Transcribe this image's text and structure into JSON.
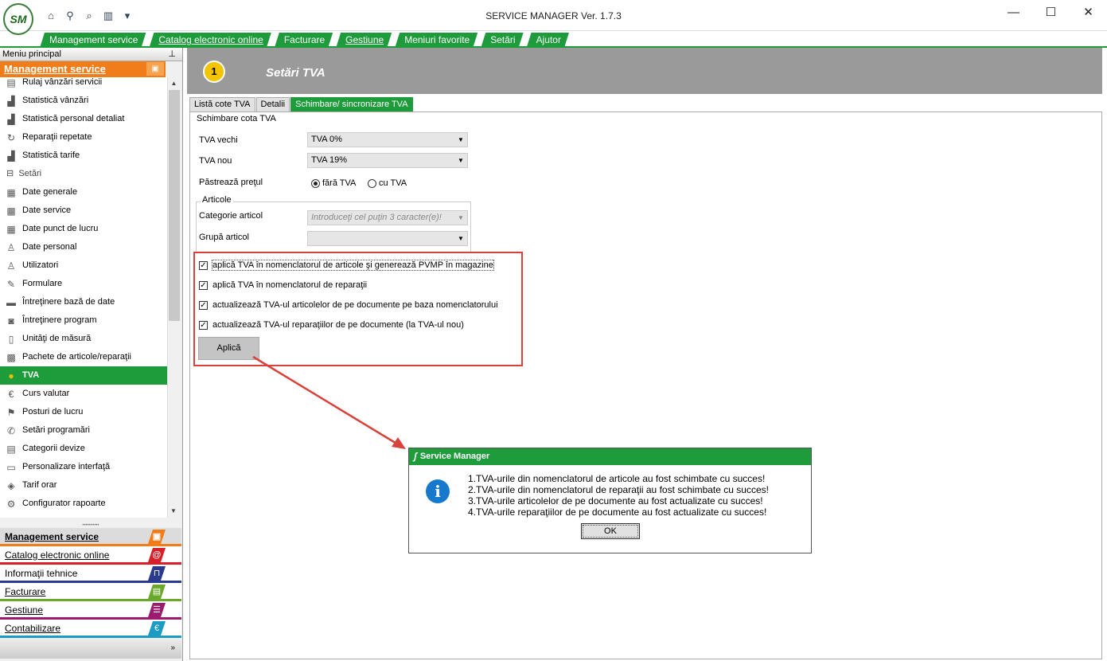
{
  "window": {
    "title": "SERVICE MANAGER Ver. 1.7.3",
    "logo_text": "SM",
    "minimize": "—",
    "maximize": "☐",
    "close": "✕"
  },
  "menu": {
    "items": [
      {
        "label": "Management service"
      },
      {
        "label": "Catalog electronic online"
      },
      {
        "label": "Facturare"
      },
      {
        "label": "Gestiune"
      },
      {
        "label": "Meniuri favorite"
      },
      {
        "label": "Setări"
      },
      {
        "label": "Ajutor"
      }
    ]
  },
  "left_panel": {
    "header": "Meniu principal",
    "module": "Management service",
    "items_top": [
      {
        "label": "Rulaj vânzări servicii"
      },
      {
        "label": "Statistică vânzări"
      },
      {
        "label": "Statistică personal detaliat"
      },
      {
        "label": "Reparaţii repetate"
      },
      {
        "label": "Statistică tarife"
      }
    ],
    "group": "Setări",
    "items_settings": [
      {
        "label": "Date generale"
      },
      {
        "label": "Date service"
      },
      {
        "label": "Date punct de lucru"
      },
      {
        "label": "Date personal"
      },
      {
        "label": "Utilizatori"
      },
      {
        "label": "Formulare"
      },
      {
        "label": "Întreţinere bază de date"
      },
      {
        "label": "Întreţinere program"
      },
      {
        "label": "Unităţi de măsură"
      },
      {
        "label": "Pachete de articole/reparaţii"
      },
      {
        "label": "TVA"
      },
      {
        "label": "Curs valutar"
      },
      {
        "label": "Posturi de lucru"
      },
      {
        "label": "Setări programări"
      },
      {
        "label": "Categorii devize"
      },
      {
        "label": "Personalizare interfaţă"
      },
      {
        "label": "Tarif orar"
      },
      {
        "label": "Configurator rapoarte"
      }
    ],
    "modules_bottom": [
      {
        "label": "Management service",
        "color": "#f07d1a"
      },
      {
        "label": "Catalog electronic online",
        "color": "#d9202a"
      },
      {
        "label": "Informaţii tehnice",
        "color": "#2a3a8f"
      },
      {
        "label": "Facturare",
        "color": "#6aa82a"
      },
      {
        "label": "Gestiune",
        "color": "#9c1b6f"
      },
      {
        "label": "Contabilizare",
        "color": "#1c9bc4"
      }
    ]
  },
  "content": {
    "title": "Setări TVA",
    "header_icon": "1",
    "tabs": [
      {
        "label": "Listă cote TVA"
      },
      {
        "label": "Detalii"
      },
      {
        "label": "Schimbare/ sincronizare TVA"
      }
    ],
    "group_change": "Schimbare cota TVA",
    "tva_old_label": "TVA vechi",
    "tva_old_value": "TVA 0%",
    "tva_new_label": "TVA nou",
    "tva_new_value": "TVA 19%",
    "keep_price_label": "Păstrează preţul",
    "radio_without": "fără TVA",
    "radio_with": "cu TVA",
    "group_articles": "Articole",
    "category_label": "Categorie articol",
    "category_placeholder": "Introduceţi cel puţin 3 caracter(e)!",
    "group_article_label": "Grupă articol",
    "group_article_value": "",
    "checks": [
      {
        "label": "aplică TVA în nomenclatorul de articole şi generează PVMP în magazine",
        "checked": true
      },
      {
        "label": "aplică TVA în nomenclatorul de reparaţii",
        "checked": true
      },
      {
        "label": "actualizează TVA-ul articolelor de pe documente pe baza nomenclatorului",
        "checked": true
      },
      {
        "label": "actualizează TVA-ul reparaţiilor de pe documente (la TVA-ul nou)",
        "checked": true
      }
    ],
    "apply_button": "Aplică"
  },
  "dialog": {
    "title": "Service Manager",
    "lines": [
      "1.TVA-urile din nomenclatorul de articole au fost schimbate cu succes!",
      "2.TVA-urile din nomenclatorul de reparaţii au fost schimbate cu succes!",
      "3.TVA-urile articolelor de pe documente au fost actualizate cu succes!",
      "4.TVA-urile reparaţiilor de pe documente au fost actualizate cu succes!"
    ],
    "ok_button": "OK"
  },
  "colors": {
    "accent_green": "#1e9c3c",
    "module_orange": "#f07d1a",
    "annotation_red": "#d9413a"
  }
}
